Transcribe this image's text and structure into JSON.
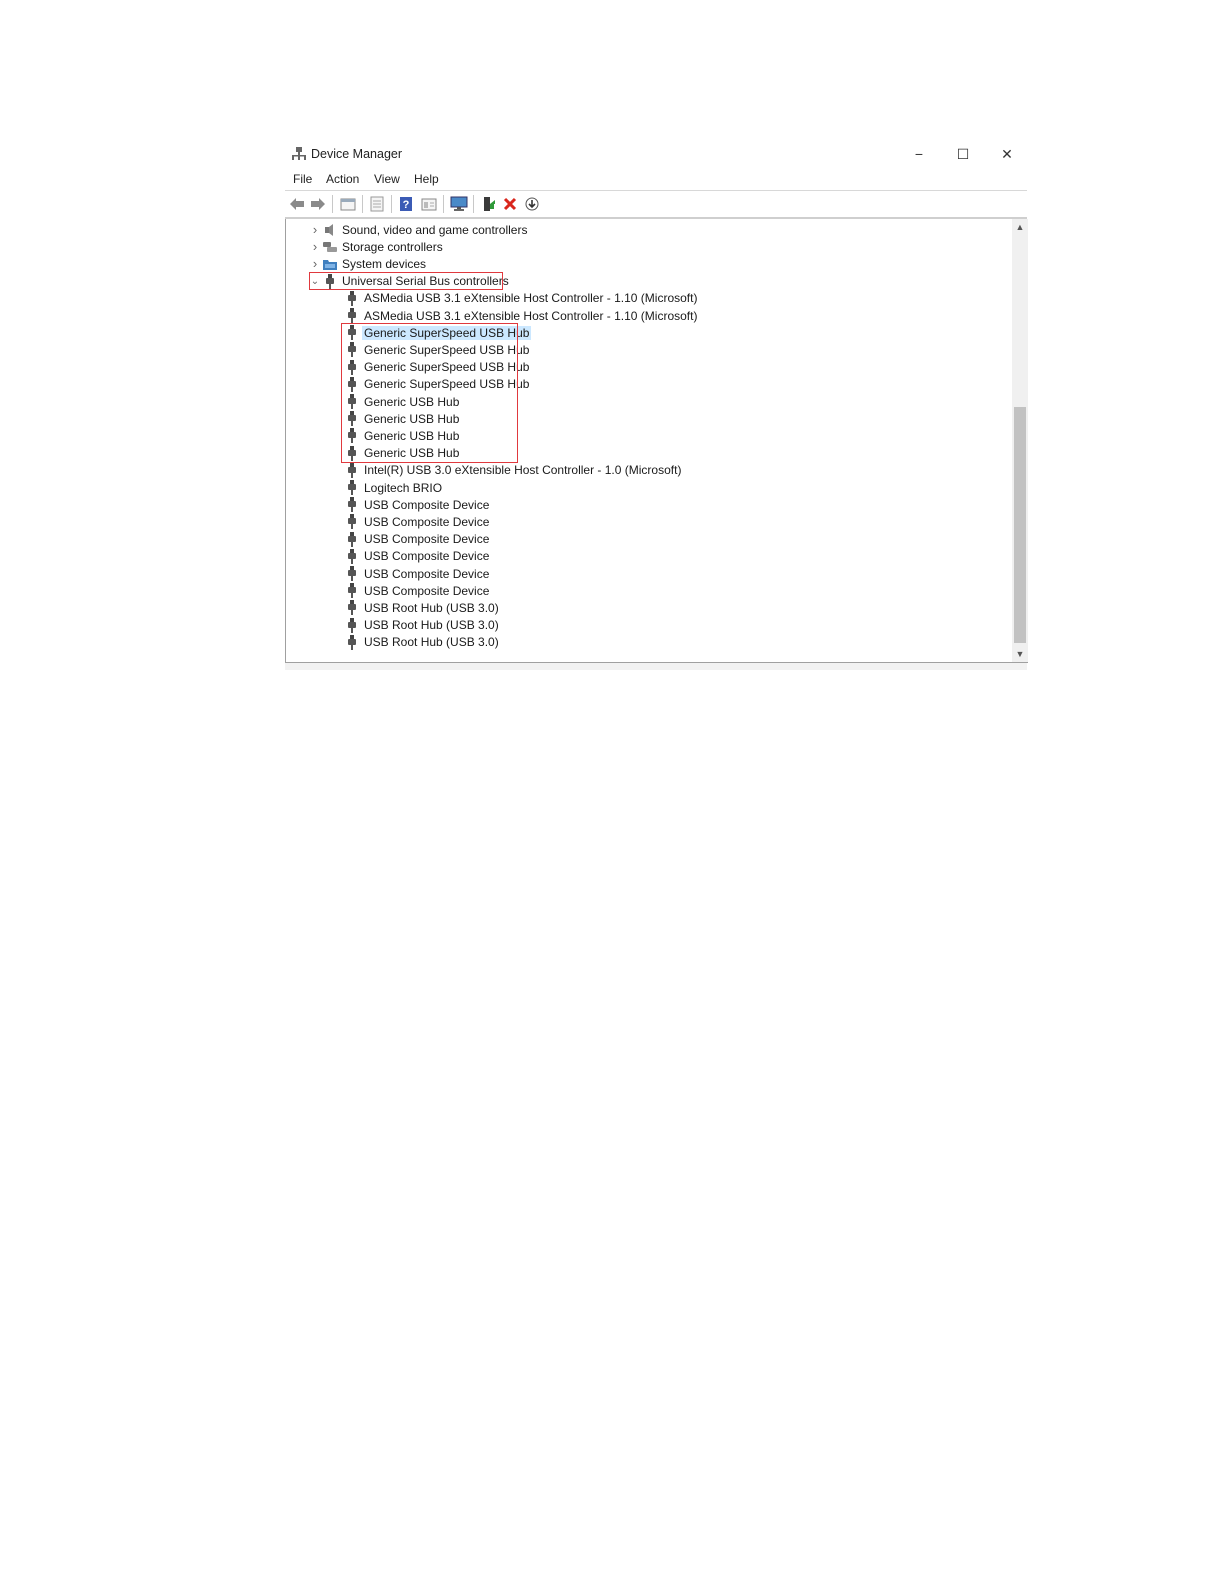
{
  "window": {
    "title": "Device Manager",
    "minimize_label": "−",
    "maximize_label": "☐",
    "close_label": "✕"
  },
  "menu": [
    "File",
    "Action",
    "View",
    "Help"
  ],
  "toolbar": {
    "buttons": [
      "back-arrow-icon",
      "forward-arrow-icon",
      "properties-icon",
      "show-hide-icon",
      "help-icon",
      "details-icon",
      "scan-hardware-icon",
      "update-driver-icon",
      "uninstall-icon",
      "download-icon"
    ]
  },
  "tree": {
    "categories": [
      {
        "label": "Sound, video and game controllers",
        "expanded": false,
        "icon": "speaker-icon"
      },
      {
        "label": "Storage controllers",
        "expanded": false,
        "icon": "storage-icon"
      },
      {
        "label": "System devices",
        "expanded": false,
        "icon": "folder-icon"
      },
      {
        "label": "Universal Serial Bus controllers",
        "expanded": true,
        "icon": "usb-icon"
      }
    ],
    "usb_devices": [
      "ASMedia USB 3.1 eXtensible Host Controller - 1.10 (Microsoft)",
      "ASMedia USB 3.1 eXtensible Host Controller - 1.10 (Microsoft)",
      "Generic SuperSpeed USB Hub",
      "Generic SuperSpeed USB Hub",
      "Generic SuperSpeed USB Hub",
      "Generic SuperSpeed USB Hub",
      "Generic USB Hub",
      "Generic USB Hub",
      "Generic USB Hub",
      "Generic USB Hub",
      "Intel(R) USB 3.0 eXtensible Host Controller - 1.0 (Microsoft)",
      "Logitech BRIO",
      "USB Composite Device",
      "USB Composite Device",
      "USB Composite Device",
      "USB Composite Device",
      "USB Composite Device",
      "USB Composite Device",
      "USB Root Hub (USB 3.0)",
      "USB Root Hub (USB 3.0)",
      "USB Root Hub (USB 3.0)"
    ],
    "selected_device_index": 2
  },
  "colors": {
    "highlight_box": "#e0393e",
    "selection": "#cce8ff"
  }
}
